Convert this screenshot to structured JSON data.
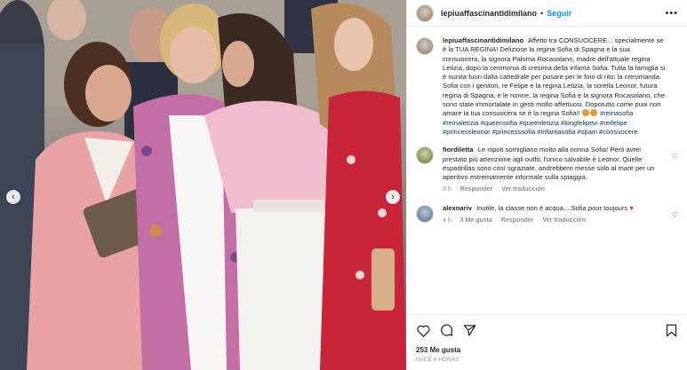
{
  "header": {
    "username": "lepiuaffascinantidimilano",
    "separator": "•",
    "follow_label": "Seguir",
    "more_icon": "more-horizontal-icon"
  },
  "caption": {
    "username": "lepiuaffascinantidimilano",
    "text": "Affetto tra CONSUOCERE... specialmente se è la TUA REGINA! Deliziose la regina Sofia di Spagna e la sua consuocera, la signora Paloma Rocasolano, madre dell'attuale regina Letizia, dopo la cerimonia di cresima della infanta Sofia. Tutta la famiglia si è riunita fuori dalla cattedrale per posare per le foto di rito: la cresimanda Sofia con i genitori, re Felipe e la regina Letizia, la sorella Leonor, futura regina di Spagna, e le nonne, la regina Sofia e la signora Rocasolano, che sono state immortalate in gesti molto affettuosi. Dopotutto come puoi non amare la tua consuocera se è la regina Sofia!!",
    "hashtags": "#reinasofia #reinaletizia #queensofia #queenletizia #kingfelipevi #reifelipe #princessleonor #princesssofia #infantasofia #spain #consuocere"
  },
  "comments": [
    {
      "username": "fiordiletta",
      "text": "Le nipoti somigliano molto alla nonna Sofia! Però avrei prestato più attenzione agli outfit; l'unico salvabile è Leonor. Quelle espadrillas sono così sgraziate, andrebbero messe solo al mare per un aperitivo estremamente informale sulla spiaggia.",
      "time": "3 h",
      "reply": "Responder",
      "translate": "Ver traducción"
    },
    {
      "username": "alexnariv",
      "text": "Inutile, la classe non è acqua....Sofia pour toujours",
      "time": "4 h",
      "likes": "3 Me gusta",
      "reply": "Responder",
      "translate": "Ver traducción"
    }
  ],
  "footer": {
    "likes": "253 Me gusta",
    "time": "HACE 6 HORAS"
  },
  "colors": {
    "link_blue": "#0095f6",
    "hashtag_blue": "#00376b",
    "heart_red": "#e0245e",
    "pink_jacket": "#e79aa3",
    "red_dress": "#c8243a"
  }
}
